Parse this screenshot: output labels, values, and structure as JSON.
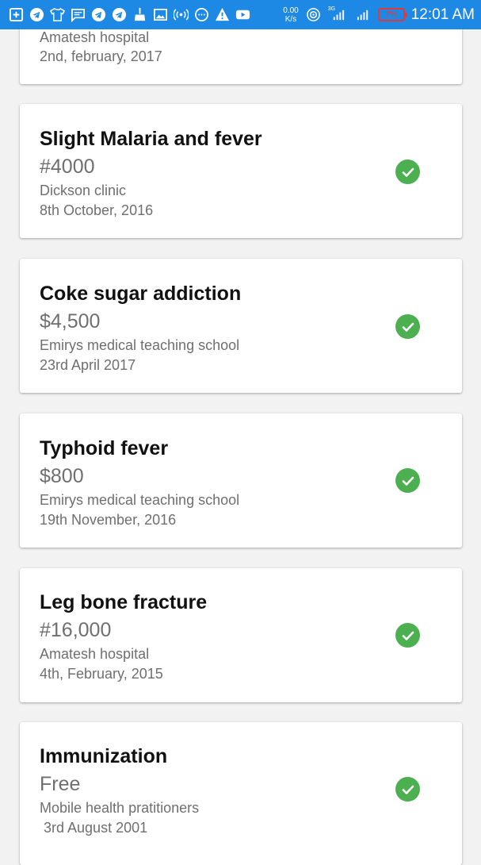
{
  "status_bar": {
    "left_icons": [
      "add-box-icon",
      "telegram-icon",
      "tshirt-icon",
      "message-icon",
      "telegram-icon",
      "telegram-icon",
      "broom-icon",
      "image-icon",
      "hotspot-icon",
      "chat-bubble-icon",
      "warning-icon",
      "youtube-icon"
    ],
    "net_speed_value": "0.00",
    "net_speed_unit": "K/s",
    "network_type": "3G",
    "battery": "7%",
    "time": "12:01 AM",
    "colors": {
      "background": "#1e88e5",
      "battery_low": "#e53935"
    }
  },
  "records": [
    {
      "title": "",
      "price": "",
      "place": "Amatesh hospital",
      "date": "2nd, february, 2017",
      "status": "check-circle-icon"
    },
    {
      "title": "Slight Malaria and fever",
      "price": "#4000",
      "place": "Dickson clinic",
      "date": "8th October, 2016",
      "status": "check-circle-icon"
    },
    {
      "title": "Coke sugar addiction",
      "price": "$4,500",
      "place": "Emirys medical teaching school",
      "date": "23rd April 2017",
      "status": "check-circle-icon"
    },
    {
      "title": "Typhoid fever",
      "price": "$800",
      "place": "Emirys medical teaching school",
      "date": "19th November, 2016",
      "status": "check-circle-icon"
    },
    {
      "title": "Leg bone fracture",
      "price": "#16,000",
      "place": "Amatesh hospital",
      "date": "4th, February, 2015",
      "status": "check-circle-icon"
    },
    {
      "title": "Immunization",
      "price": "Free",
      "place": "Mobile health pratitioners",
      "date": " 3rd August 2001",
      "status": "check-circle-icon"
    }
  ],
  "colors": {
    "check": "#4caf50",
    "title": "#111111",
    "secondary": "#6f6f6f"
  }
}
